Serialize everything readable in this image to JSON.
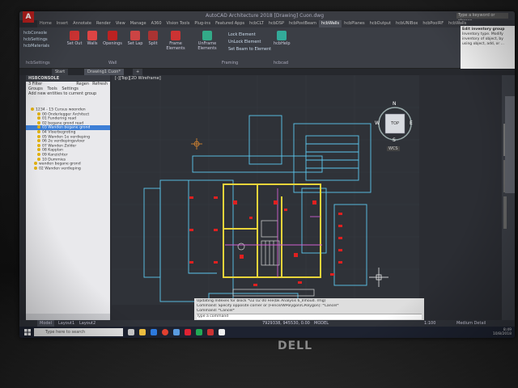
{
  "window": {
    "app_badge": "A",
    "title": "AutoCAD Architecture 2018   [Drawing] Cuon.dwg",
    "search_placeholder": "Type a keyword or phrase"
  },
  "ribbon_tabs": [
    "Home",
    "Insert",
    "Annotate",
    "Render",
    "View",
    "Manage",
    "A360",
    "Vision Tools",
    "Plug-ins",
    "Featured Apps",
    "hcbCLT",
    "hcbDSP",
    "hcbPostBeam",
    "hcbWalls",
    "hcbPlanes",
    "hcbOutput",
    "hcbUNIBox",
    "hcbPoolRF",
    "hcbWalls"
  ],
  "ribbon": {
    "buttons": [
      "hcbConsole",
      "hcbSettings",
      "hcbMaterials",
      "Set Out",
      "Walls",
      "Openings",
      "Set Lap",
      "Split",
      "Frame Elements",
      "UnFrame Elements",
      "Lock Element",
      "UnLock Element",
      "Set Beam to Element",
      "hcbHelp"
    ],
    "panels": [
      "hcbSettings",
      "Wall",
      "Framing",
      "hcbcad"
    ]
  },
  "popup": {
    "title": "Edit inventory group",
    "text": "Inventory type. Modify inventory of object, by using object, add, or ..."
  },
  "doc_tabs": [
    "Start",
    "Drawing1 Cuon*",
    "+"
  ],
  "palette": {
    "header": "HSBCONSOLE",
    "filter": "3 Filter",
    "buttons": [
      "Regen",
      "Refresh"
    ],
    "tabs": [
      "Groups",
      "Tools",
      "Settings"
    ],
    "add_label": "Add new entities to current group",
    "tree": [
      "1234 - 15 Cursus woonden",
      "00 Onderlegger Architect",
      "01 Fundering read",
      "02 begane grond read",
      "03 Wanden begane grond",
      "04 Vloerbegroting",
      "05 Wanden 1e verdieping",
      "06 2e verdiepingsvloer",
      "07 Wanden Zolder",
      "08 Kapplan",
      "09 Kanzichter",
      "10 Dummies",
      "wanden begane grond",
      "02 Wanden verdieping"
    ],
    "selected_index": 4
  },
  "viewport": {
    "label": "[-][Top][2D Wireframe]",
    "compass": [
      "N",
      "E",
      "S",
      "W"
    ],
    "cube_face": "TOP",
    "wcs": "WCS"
  },
  "right_panel": {
    "tabs": [
      "Design",
      "Display",
      "Extended Data"
    ]
  },
  "command": {
    "lines": [
      "Updating Indexes for block *U2 02 00 File(bk Analysis 6_Inhoud. rmg)",
      "Command: Specify opposite corner or [Fence/WPolygon/CPolygon]: *Cancel*",
      "Command: *Cancel*"
    ],
    "prompt": "Type a command"
  },
  "status": {
    "model_tab": "Model",
    "layouts": [
      "Layout1",
      "Layout2"
    ],
    "coords": "7929338, 945530, 0.00",
    "mode": "MODEL",
    "scale": "1:100",
    "detail": "Medium Detail"
  },
  "taskbar": {
    "search": "Type here to search",
    "time": "8:49",
    "date": "10/8/2018"
  },
  "brand": "DELL",
  "colors": {
    "autocad_red": "#c0201e",
    "drawing_bg": "#2f3238",
    "wall_yellow": "#e8d43a",
    "cad_cyan": "#5cc7ee",
    "marker_red": "#e02020"
  }
}
